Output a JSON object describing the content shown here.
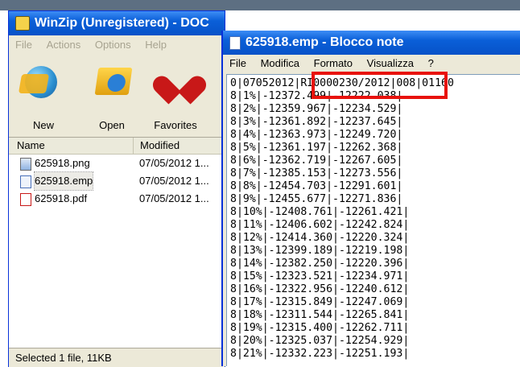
{
  "winzip": {
    "title": "WinZip (Unregistered) - DOC",
    "menu": [
      "File",
      "Actions",
      "Options",
      "Help"
    ],
    "toolbar": [
      {
        "label": "New",
        "icon": "new-archive-icon"
      },
      {
        "label": "Open",
        "icon": "open-archive-icon"
      },
      {
        "label": "Favorites",
        "icon": "favorites-heart-icon"
      }
    ],
    "columns": {
      "name": "Name",
      "modified": "Modified"
    },
    "files": [
      {
        "name": "625918.png",
        "modified": "07/05/2012 1...",
        "icon": "png-file-icon"
      },
      {
        "name": "625918.emp",
        "modified": "07/05/2012 1...",
        "icon": "emp-file-icon",
        "selected": true
      },
      {
        "name": "625918.pdf",
        "modified": "07/05/2012 1...",
        "icon": "pdf-file-icon"
      }
    ],
    "status": "Selected 1 file, 11KB"
  },
  "notepad": {
    "title": "625918.emp - Blocco note",
    "menu": [
      "File",
      "Modifica",
      "Formato",
      "Visualizza",
      "?"
    ],
    "lines": [
      "0|07052012|RI0000230/2012|008|01160",
      "8|1%|-12372.499|-12222.038|",
      "8|2%|-12359.967|-12234.529|",
      "8|3%|-12361.892|-12237.645|",
      "8|4%|-12363.973|-12249.720|",
      "8|5%|-12361.197|-12262.368|",
      "8|6%|-12362.719|-12267.605|",
      "8|7%|-12385.153|-12273.556|",
      "8|8%|-12454.703|-12291.601|",
      "8|9%|-12455.677|-12271.836|",
      "8|10%|-12408.761|-12261.421|",
      "8|11%|-12406.602|-12242.824|",
      "8|12%|-12414.360|-12220.324|",
      "8|13%|-12399.189|-12219.198|",
      "8|14%|-12382.250|-12220.396|",
      "8|15%|-12323.521|-12234.971|",
      "8|16%|-12322.956|-12240.612|",
      "8|17%|-12315.849|-12247.069|",
      "8|18%|-12311.544|-12265.841|",
      "8|19%|-12315.400|-12262.711|",
      "8|20%|-12325.037|-12254.929|",
      "8|21%|-12332.223|-12251.193|"
    ],
    "highlight_color": "#e8120c"
  }
}
